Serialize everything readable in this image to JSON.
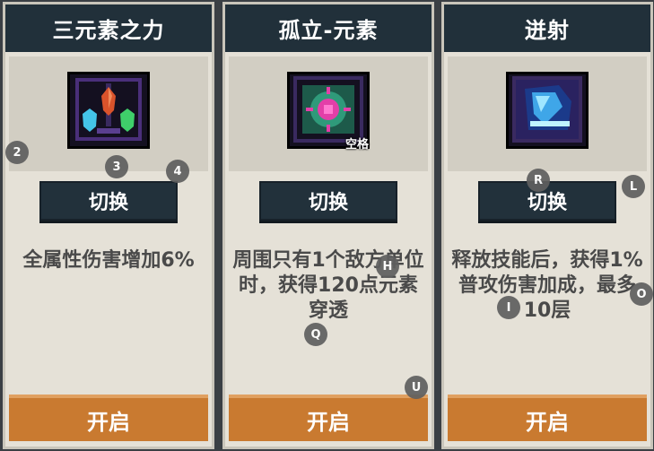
{
  "cards": [
    {
      "title": "三元素之力",
      "switch_label": "切换",
      "description": "全属性伤害增加6%",
      "open_label": "开启",
      "key_hint": ""
    },
    {
      "title": "孤立-元素",
      "switch_label": "切换",
      "description": "周围只有1个敌方单位时，获得120点元素穿透",
      "open_label": "开启",
      "key_hint": "空格"
    },
    {
      "title": "迸射",
      "switch_label": "切换",
      "description": "释放技能后，获得1%普攻伤害加成，最多10层",
      "open_label": "开启",
      "key_hint": ""
    }
  ],
  "markers": {
    "m2": "2",
    "m3": "3",
    "m4": "4",
    "mH": "H",
    "mQ": "Q",
    "mU": "U",
    "mR": "R",
    "mL": "L",
    "mI": "I",
    "mO": "O"
  },
  "colors": {
    "title_bar": "#21303a",
    "card_bg": "#e5e1d7",
    "open_button": "#c97a30",
    "desc_text": "#4a4a4a"
  }
}
